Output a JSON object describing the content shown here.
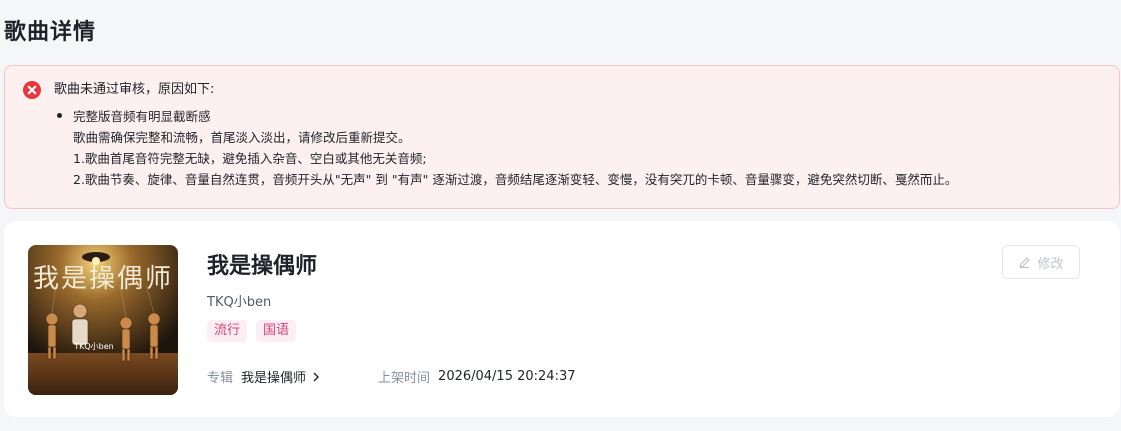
{
  "page": {
    "title": "歌曲详情"
  },
  "alert": {
    "icon": "error-circle-icon",
    "color": "#e8373f",
    "title": "歌曲未通过审核，原因如下:",
    "reasons": [
      {
        "lines": [
          "完整版音频有明显截断感",
          "歌曲需确保完整和流畅，首尾淡入淡出，请修改后重新提交。",
          "1.歌曲首尾音符完整无缺，避免插入杂音、空白或其他无关音频;",
          "2.歌曲节奏、旋律、音量自然连贯，音频开头从\"无声\" 到 \"有声\" 逐渐过渡，音频结尾逐渐变轻、变慢，没有突兀的卡顿、音量骤变，避免突然切断、戛然而止。"
        ]
      }
    ]
  },
  "song": {
    "title": "我是操偶师",
    "artist": "TKQ小ben",
    "cover_text": "我是操偶师",
    "cover_credit": "TKQ小ben",
    "tags": [
      "流行",
      "国语"
    ],
    "album_label": "专辑",
    "album_value": "我是操偶师",
    "release_label": "上架时间",
    "release_value": "2026/04/15 20:24:37",
    "edit_label": "修改",
    "tag_color": "#d6427a"
  }
}
